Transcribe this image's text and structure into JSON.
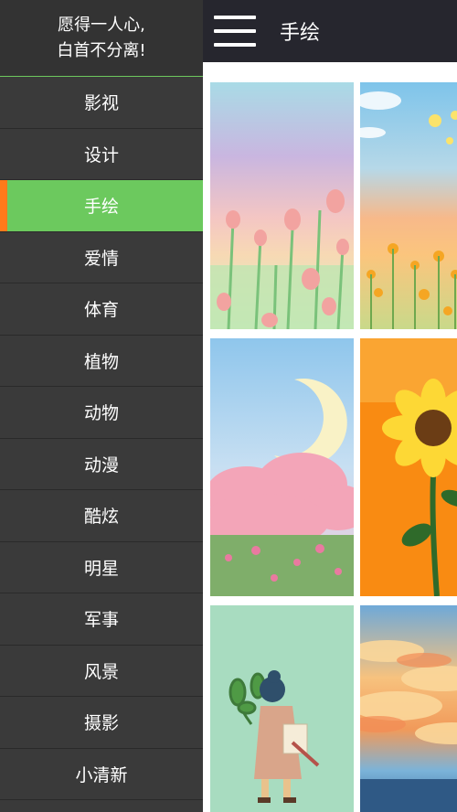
{
  "drawer": {
    "header_line1": "愿得一人心,",
    "header_line2": "白首不分离!",
    "items": [
      {
        "label": "影视"
      },
      {
        "label": "设计"
      },
      {
        "label": "手绘"
      },
      {
        "label": "爱情"
      },
      {
        "label": "体育"
      },
      {
        "label": "植物"
      },
      {
        "label": "动物"
      },
      {
        "label": "动漫"
      },
      {
        "label": "酷炫"
      },
      {
        "label": "明星"
      },
      {
        "label": "军事"
      },
      {
        "label": "风景"
      },
      {
        "label": "摄影"
      },
      {
        "label": "小清新"
      }
    ],
    "active_index": 2
  },
  "toolbar": {
    "title": "手绘",
    "menu_icon": "hamburger-menu-icon"
  },
  "images": [
    {
      "name": "tulip-field-painting"
    },
    {
      "name": "sunset-flower-field-painting"
    },
    {
      "name": "crescent-moon-pink-clouds-painting"
    },
    {
      "name": "sunflower-orange-painting"
    },
    {
      "name": "girl-carrying-plant-illustration"
    },
    {
      "name": "sunset-sky-clouds-painting"
    }
  ],
  "colors": {
    "accent_green": "#6cc95e",
    "active_marker": "#ff7a1a",
    "drawer_bg": "#3a3a3a",
    "topbar_bg": "#26262e"
  }
}
